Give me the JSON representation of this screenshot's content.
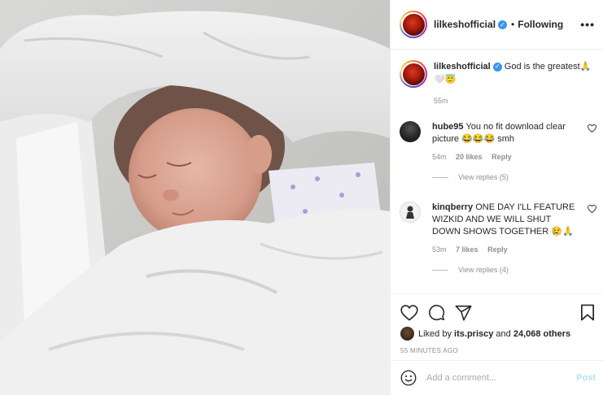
{
  "post": {
    "image_alt": "sleeping newborn baby wrapped in a white blanket",
    "header": {
      "username": "lilkeshofficial",
      "separator": "•",
      "follow_status": "Following",
      "more_icon": "more-horizontal-icon"
    },
    "caption": {
      "username": "lilkeshofficial",
      "text": "God is the greatest🙏🤍😇",
      "time": "55m"
    },
    "comments": [
      {
        "username": "hube95",
        "text": "You no fit download clear picture 😂😂😂 smh",
        "time": "54m",
        "likes": "20 likes",
        "reply": "Reply",
        "view_replies": "View replies (5)"
      },
      {
        "username": "kinqberry",
        "text": "ONE DAY I'LL FEATURE WIZKID AND WE WILL SHUT DOWN SHOWS TOGETHER 😢🙏",
        "time": "53m",
        "likes": "7 likes",
        "reply": "Reply",
        "view_replies": "View replies (4)"
      }
    ],
    "likes": {
      "prefix": "Liked by",
      "user": "its.priscy",
      "middle": "and",
      "others": "24,068 others"
    },
    "timestamp": "55 MINUTES AGO",
    "add_comment": {
      "placeholder": "Add a comment...",
      "post_label": "Post"
    }
  },
  "colors": {
    "verified": "#3897f0",
    "post_button_disabled": "#b2dffc",
    "muted_text": "#8e8e8e"
  }
}
